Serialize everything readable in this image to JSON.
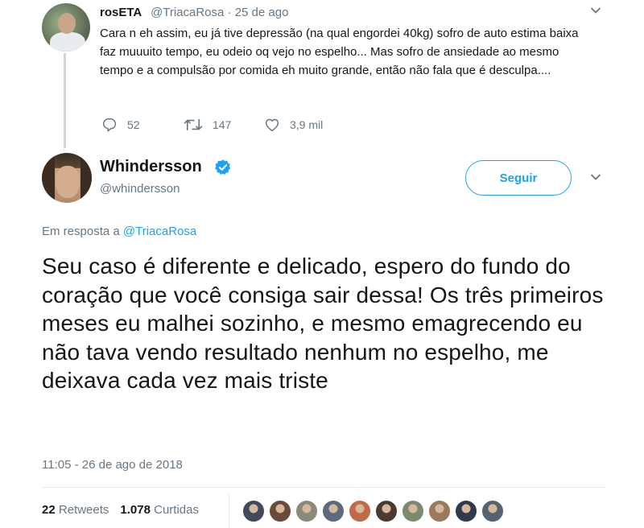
{
  "parent_tweet": {
    "name": "rosETA",
    "handle": "@TriacaRosa",
    "date": "· 25 de ago",
    "text": "Cara n eh assim, eu já tive depressão (na qual engordei 40kg) sofro de auto estima baixa faz muuuito tempo, eu odeio oq vejo no espelho... Mas sofro de ansiedade ao mesmo tempo e a compulsão por comida eh muito grande, então não fala que é desculpa....",
    "replies": "52",
    "retweets": "147",
    "likes": "3,9 mil"
  },
  "main_tweet": {
    "name": "Whindersson",
    "handle": "@whindersson",
    "follow_label": "Seguir",
    "reply_prefix": "Em resposta a",
    "reply_to": "@TriacaRosa",
    "text": "Seu caso é diferente e delicado, espero do fundo do coração que você consiga sair dessa! Os três primeiros meses eu malhei sozinho, e mesmo emagrecendo eu não tava vendo resultado nenhum no espelho, me deixava cada vez mais triste",
    "timestamp": "11:05 - 26 de ago de 2018",
    "retweet_count": "22",
    "retweet_label": "Retweets",
    "like_count": "1.078",
    "like_label": "Curtidas"
  },
  "colors": {
    "accent": "#1da1f2",
    "text": "#14171a",
    "muted": "#657786",
    "border": "#e6ecf0"
  },
  "icons": [
    "reply-icon",
    "retweet-icon",
    "like-icon",
    "chevron-down-icon",
    "verified-badge-icon"
  ],
  "likers": [
    "#3f4a5a",
    "#6b4a3a",
    "#8a8a7a",
    "#5b6b7c",
    "#c06a4a",
    "#4a3a2f",
    "#7a8a6a",
    "#9a7a5a",
    "#2f3b4a",
    "#556270"
  ]
}
